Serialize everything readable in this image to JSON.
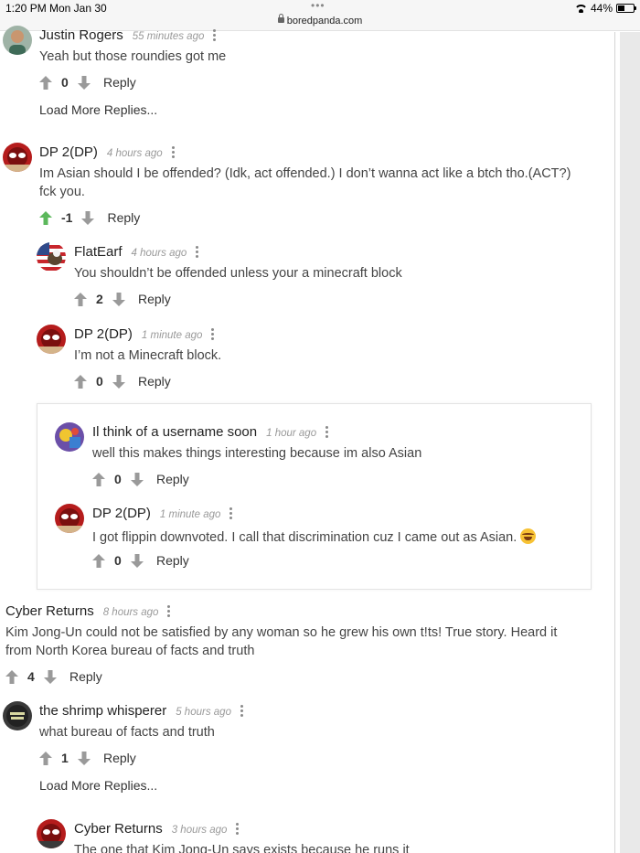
{
  "status_bar": {
    "time": "1:20 PM",
    "date": "Mon Jan 30",
    "url": "boredpanda.com",
    "battery": "44%",
    "battery_level": 0.44,
    "icons": [
      "lock-icon",
      "wifi-icon",
      "battery-icon"
    ]
  },
  "reply_label": "Reply",
  "load_more_label": "Load More Replies...",
  "colors": {
    "upvote_active": "#5cb85c",
    "vote_inactive": "#9a9a9a"
  },
  "comments": [
    {
      "author": "Justin Rogers",
      "time": "55 minutes ago",
      "text": [
        "Yeah but those roundies got me"
      ],
      "score": "0"
    },
    {
      "author": "DP 2(DP)",
      "time": "4 hours ago",
      "text": [
        "Im Asian should I be offended? (Idk, act offended.) I don’t wanna act like a btch tho.(ACT?)",
        "fck you."
      ],
      "score": "-1",
      "upvoted": true
    },
    {
      "author": "FlatEarf",
      "time": "4 hours ago",
      "text": [
        "You shouldn’t be offended unless your a minecraft block"
      ],
      "score": "2"
    },
    {
      "author": "DP 2(DP)",
      "time": "1 minute ago",
      "text": [
        "I’m not a Minecraft block."
      ],
      "score": "0"
    },
    {
      "author": "Il think of a username soon",
      "time": "1 hour ago",
      "text": [
        "well this makes things interesting because im also Asian"
      ],
      "score": "0"
    },
    {
      "author": "DP 2(DP)",
      "time": "1 minute ago",
      "text": [
        "I got flippin downvoted. I call that discrimination cuz I came out as Asian."
      ],
      "score": "0",
      "emoji": "laughing-tears-emoji"
    },
    {
      "author": "Cyber Returns",
      "time": "8 hours ago",
      "text": [
        "Kim Jong-Un could not be satisfied by any woman so he grew his own t!ts! True story. Heard it",
        "from North Korea bureau of facts and truth"
      ],
      "score": "4"
    },
    {
      "author": "the shrimp whisperer",
      "time": "5 hours ago",
      "text": [
        "what bureau of facts and truth"
      ],
      "score": "1"
    },
    {
      "author": "Cyber Returns",
      "time": "3 hours ago",
      "text": [
        "The one that Kim Jong-Un says exists because he runs it"
      ]
    }
  ]
}
